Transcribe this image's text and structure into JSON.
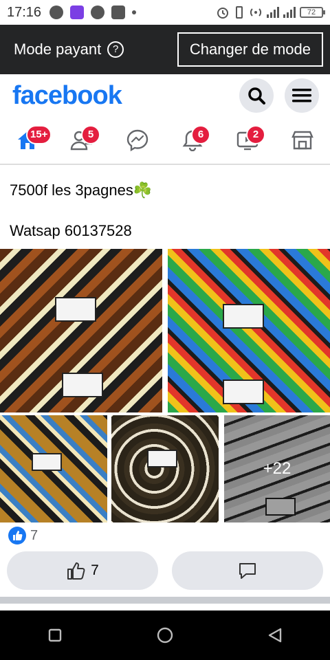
{
  "status_bar": {
    "time": "17:16",
    "battery": "72"
  },
  "mode_bar": {
    "label": "Mode payant",
    "help_glyph": "?",
    "change_button": "Changer de mode"
  },
  "header": {
    "logo": "facebook",
    "icons": [
      "search-icon",
      "menu-icon"
    ]
  },
  "nav": {
    "items": [
      {
        "name": "home",
        "badge": "15+"
      },
      {
        "name": "friends",
        "badge": "5"
      },
      {
        "name": "messenger",
        "badge": ""
      },
      {
        "name": "notifications",
        "badge": "6"
      },
      {
        "name": "watch",
        "badge": "2"
      },
      {
        "name": "marketplace",
        "badge": ""
      }
    ]
  },
  "post": {
    "line1": "7500f les 3pagnes☘️",
    "line2": "Watsap 60137528",
    "more_photos": "+22",
    "reaction_count": "7",
    "like_count": "7"
  },
  "colors": {
    "brand": "#1877f2",
    "badge": "#e41e3f",
    "mode_bar": "#242526"
  }
}
